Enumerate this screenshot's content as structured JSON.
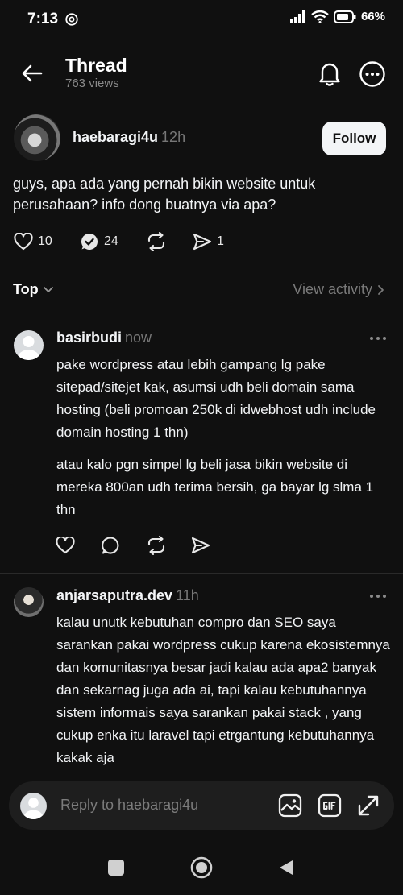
{
  "status_bar": {
    "time": "7:13",
    "battery": "66%"
  },
  "header": {
    "title": "Thread",
    "views": "763 views",
    "back_icon": "arrow-left-icon",
    "bell_icon": "bell-icon",
    "more_icon": "more-circle-icon"
  },
  "post": {
    "username": "haebaragi4u",
    "time": "12h",
    "follow_label": "Follow",
    "text": "guys, apa ada yang pernah bikin website untuk perusahaan? info dong buatnya via apa?",
    "likes": "10",
    "replies": "24",
    "shares": "1"
  },
  "sort": {
    "label": "Top",
    "view_activity": "View activity"
  },
  "replies": [
    {
      "username": "basirbudi",
      "time": "now",
      "paragraphs": [
        "pake wordpress atau lebih gampang lg pake sitepad/sitejet kak, asumsi udh beli domain sama hosting (beli promoan 250k di idwebhost udh include domain hosting 1 thn)",
        "atau kalo pgn simpel lg beli jasa bikin website di mereka 800an udh terima bersih, ga bayar lg slma 1 thn"
      ]
    },
    {
      "username": "anjarsaputra.dev",
      "time": "11h",
      "paragraphs": [
        "kalau unutk kebutuhan compro dan SEO saya sarankan pakai wordpress cukup karena ekosistemnya dan komunitasnya besar jadi kalau ada apa2 banyak dan sekarnag juga ada ai,  tapi kalau kebutuhannya sistem informais saya sarankan pakai stack , yang cukup enka itu laravel tapi etrgantung kebutuhannya kakak aja"
      ]
    }
  ],
  "reply_bar": {
    "placeholder": "Reply to haebaragi4u"
  },
  "colors": {
    "background": "#101010",
    "text": "#f3f5f7",
    "muted": "#777777",
    "button_bg": "#f3f5f7"
  }
}
